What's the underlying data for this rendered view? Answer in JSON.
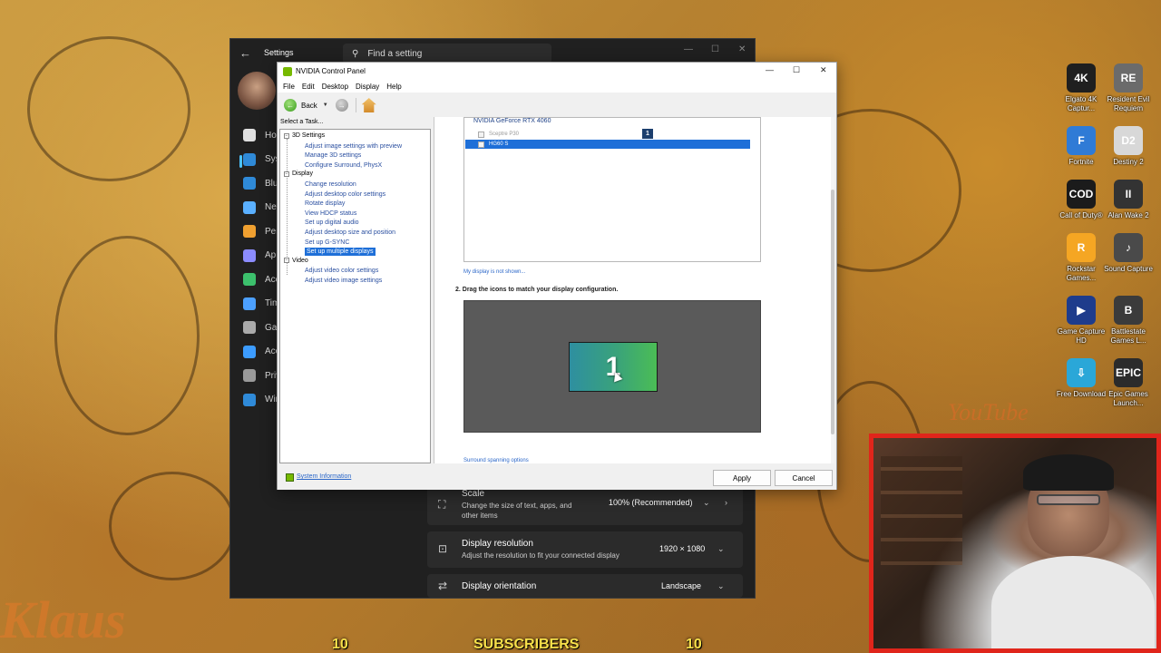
{
  "desktop": {
    "icons": [
      {
        "label": "Elgato 4K Captur...",
        "glyph": "4K",
        "color": "#1f1f1f"
      },
      {
        "label": "Resident Evil Requiem",
        "glyph": "RE",
        "color": "#6b6b6b"
      },
      {
        "label": "Fortnite",
        "glyph": "F",
        "color": "#2f7bd6"
      },
      {
        "label": "Destiny 2",
        "glyph": "D2",
        "color": "#d8d8d8"
      },
      {
        "label": "Call of Duty®",
        "glyph": "COD",
        "color": "#1b1b1b"
      },
      {
        "label": "Alan Wake 2",
        "glyph": "II",
        "color": "#333333"
      },
      {
        "label": "Rockstar Games...",
        "glyph": "R",
        "color": "#f5a623"
      },
      {
        "label": "Sound Capture",
        "glyph": "♪",
        "color": "#4a4a4a"
      },
      {
        "label": "Game Capture HD",
        "glyph": "▶",
        "color": "#1e3c8c"
      },
      {
        "label": "Battlestate Games L...",
        "glyph": "B",
        "color": "#3b3b3b"
      },
      {
        "label": "Free Download",
        "glyph": "⇩",
        "color": "#2aa7d8"
      },
      {
        "label": "Epic Games Launch...",
        "glyph": "EPIC",
        "color": "#2b2b2b"
      }
    ],
    "overlay_text": {
      "subscribers": "SUBSCRIBERS",
      "count_left": "10",
      "count_right": "10",
      "name": "Klaus",
      "youtube": "YouTube"
    }
  },
  "settings": {
    "title": "Settings",
    "search_placeholder": "Find a setting",
    "nav": [
      {
        "label": "Ho",
        "color": "#e0e0e0"
      },
      {
        "label": "Sys",
        "color": "#2f8ad8"
      },
      {
        "label": "Blu",
        "color": "#2f8ad8"
      },
      {
        "label": "Net",
        "color": "#5ab0ff"
      },
      {
        "label": "Per",
        "color": "#f0a030"
      },
      {
        "label": "Ap",
        "color": "#8c8cff"
      },
      {
        "label": "Acc",
        "color": "#3cc06c"
      },
      {
        "label": "Tim",
        "color": "#4ca0ff"
      },
      {
        "label": "Gar",
        "color": "#aaaaaa"
      },
      {
        "label": "Acc",
        "color": "#3c9cff"
      },
      {
        "label": "Priv",
        "color": "#9a9a9a"
      },
      {
        "label": "Wir",
        "color": "#2f8ad8"
      }
    ],
    "rows": {
      "scale": {
        "title": "Scale",
        "desc": "Change the size of text, apps, and other items",
        "value": "100% (Recommended)"
      },
      "resolution": {
        "title": "Display resolution",
        "desc": "Adjust the resolution to fit your connected display",
        "value": "1920 × 1080"
      },
      "orientation": {
        "title": "Display orientation",
        "value": "Landscape"
      }
    }
  },
  "nvidia": {
    "title": "NVIDIA Control Panel",
    "menu": [
      "File",
      "Edit",
      "Desktop",
      "Display",
      "Help"
    ],
    "toolbar": {
      "back": "Back"
    },
    "task_label": "Select a Task...",
    "tree": {
      "settings_3d": {
        "label": "3D Settings",
        "items": [
          "Adjust image settings with preview",
          "Manage 3D settings",
          "Configure Surround, PhysX"
        ]
      },
      "display": {
        "label": "Display",
        "items": [
          "Change resolution",
          "Adjust desktop color settings",
          "Rotate display",
          "View HDCP status",
          "Set up digital audio",
          "Adjust desktop size and position",
          "Set up G-SYNC",
          "Set up multiple displays"
        ]
      },
      "video": {
        "label": "Video",
        "items": [
          "Adjust video color settings",
          "Adjust video image settings"
        ]
      }
    },
    "content": {
      "gpu": "NVIDIA GeForce RTX 4060",
      "displays": [
        "Sceptre P30",
        "HG60 S"
      ],
      "display_badge": "1",
      "not_shown_link": "My display is not shown...",
      "step2": "2. Drag the icons to match your display configuration.",
      "monitor_number": "1",
      "surround_link": "Surround spanning options"
    },
    "footer": {
      "system_info": "System Information",
      "apply": "Apply",
      "cancel": "Cancel"
    }
  }
}
